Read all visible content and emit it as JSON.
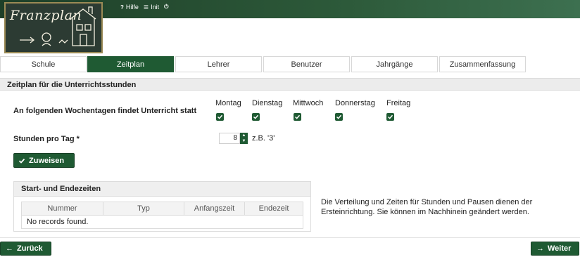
{
  "header": {
    "logo_text": "Franzplan",
    "links": [
      {
        "icon": "question-icon",
        "label": "Hilfe"
      },
      {
        "icon": "database-icon",
        "label": "Init"
      },
      {
        "icon": "power-icon",
        "label": ""
      }
    ]
  },
  "tabs": [
    {
      "label": "Schule"
    },
    {
      "label": "Zeitplan",
      "active": true
    },
    {
      "label": "Lehrer"
    },
    {
      "label": "Benutzer"
    },
    {
      "label": "Jahrgänge"
    },
    {
      "label": "Zusammenfassung"
    }
  ],
  "section": {
    "title": "Zeitplan für die Unterrichtsstunden"
  },
  "weekdays": {
    "label": "An folgenden Wochentagen findet Unterricht statt",
    "days": [
      {
        "name": "Montag",
        "checked": true
      },
      {
        "name": "Dienstag",
        "checked": true
      },
      {
        "name": "Mittwoch",
        "checked": true
      },
      {
        "name": "Donnerstag",
        "checked": true
      },
      {
        "name": "Freitag",
        "checked": true
      }
    ]
  },
  "hours": {
    "label": "Stunden pro Tag *",
    "value": "8",
    "hint": "z.B. '3'"
  },
  "assign_button": "Zuweisen",
  "times_panel": {
    "title": "Start- und Endezeiten",
    "columns": [
      "Nummer",
      "Typ",
      "Anfangszeit",
      "Endezeit"
    ],
    "empty_text": "No records found."
  },
  "info_text": "Die Verteilung und Zeiten für Stunden und Pausen dienen der Ersteinrichtung. Sie können im Nachhinein geändert werden.",
  "nav": {
    "back": "Zurück",
    "next": "Weiter"
  },
  "colors": {
    "primary": "#1f5a33",
    "header_dark": "#1e3f28"
  }
}
